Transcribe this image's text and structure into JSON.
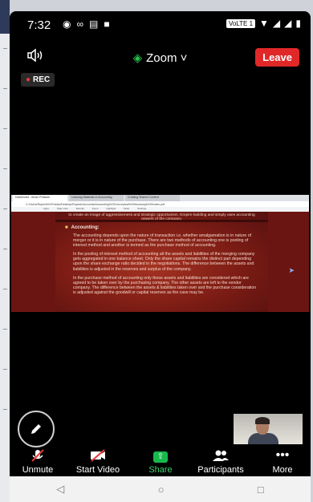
{
  "status_bar": {
    "time": "7:32",
    "network_badge": "VoLTE 1"
  },
  "meeting": {
    "title": "Zoom",
    "leave_label": "Leave",
    "rec_label": "REC"
  },
  "browser": {
    "tabs": [
      "Dashboard - Aman Prakash",
      "Learning Materials in Accounting",
      "Creating Shared Content"
    ],
    "address": "C:/Users/Rupesh%20Yadav/Desktop/Rupesh/Accounts/Accounting%20Conceptual%20Issues/ppt%20notes.pdf",
    "bookmarks": [
      "Apps",
      "Page view",
      "Rewrite",
      "Zoom",
      "Highlight",
      "Draw",
      "Settings"
    ]
  },
  "slide": {
    "top_text": "to create an image of aggressiveness and strategic opportunism. Empire building and simply uses accounting powers of the company.",
    "heading": "Accounting:",
    "paragraphs": [
      "The accounting depends upon the nature of transaction i.e. whether amalgamation is in nature of merger or it is in nature of the purchase. There are two methods of accounting one is pooling of interest method and another is termed as the purchase method of accounting.",
      "In the pooling of interest method of accounting all the assets and liabilities of the merging company gets aggregated in one balance sheet. Only the share capital remains the distinct part depending upon the share exchange ratio decided in the negotiations. The difference between the assets and liabilities is adjusted in the reserves and surplus of the company.",
      "In the purchase method of accounting only those assets and liabilities are considered which are agreed to be taken over by the purchasing company. The other assets are left to the vendor company. The difference between the assets & liabilities taken over and the purchase consideration is adjusted against the goodwill or capital reserves as the case may be."
    ]
  },
  "toolbar": {
    "unmute": "Unmute",
    "start_video": "Start Video",
    "share": "Share",
    "participants": "Participants",
    "more": "More"
  },
  "colors": {
    "leave": "#e02828",
    "share": "#18b94c",
    "rec_dot": "#e53935"
  }
}
